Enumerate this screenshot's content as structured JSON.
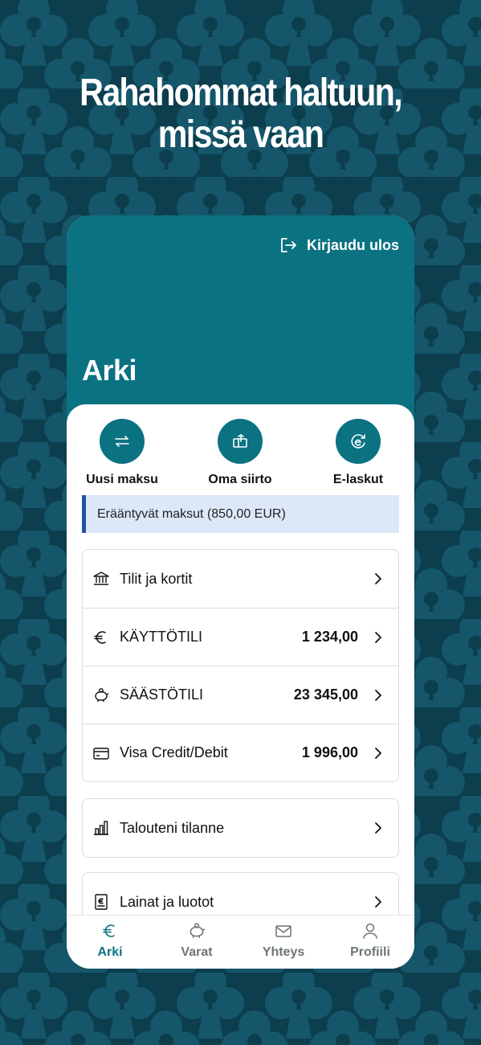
{
  "headline": {
    "line1": "Rahahommat haltuun,",
    "line2": "missä vaan"
  },
  "header": {
    "logout_label": "Kirjaudu ulos",
    "title": "Arki"
  },
  "actions": [
    {
      "label": "Uusi maksu",
      "icon": "transfer-arrows-icon"
    },
    {
      "label": "Oma siirto",
      "icon": "own-transfer-icon"
    },
    {
      "label": "E-laskut",
      "icon": "e-invoice-icon"
    }
  ],
  "notice": {
    "text": "Erääntyvät maksut (850,00 EUR)"
  },
  "accounts_card": {
    "header": {
      "label": "Tilit ja kortit",
      "icon": "bank-icon"
    },
    "rows": [
      {
        "label": "KÄYTTÖTILI",
        "amount": "1 234,00",
        "icon": "euro-icon"
      },
      {
        "label": "SÄÄSTÖTILI",
        "amount": "23 345,00",
        "icon": "piggy-bank-icon"
      },
      {
        "label": "Visa Credit/Debit",
        "amount": "1 996,00",
        "icon": "credit-card-icon"
      }
    ]
  },
  "finance_card": {
    "label": "Talouteni tilanne",
    "icon": "bar-chart-icon"
  },
  "loans_card": {
    "label": "Lainat ja luotot",
    "icon": "loan-document-icon"
  },
  "bottom_nav": [
    {
      "label": "Arki",
      "icon": "euro-icon",
      "active": true
    },
    {
      "label": "Varat",
      "icon": "piggy-bank-icon",
      "active": false
    },
    {
      "label": "Yhteys",
      "icon": "envelope-icon",
      "active": false
    },
    {
      "label": "Profiili",
      "icon": "person-icon",
      "active": false
    }
  ],
  "colors": {
    "background": "#0c3e4e",
    "pattern": "#15566a",
    "primary": "#0b7282",
    "notice_bg": "#dce7f8",
    "notice_border": "#2750a8",
    "nav_inactive": "#6c7478"
  }
}
